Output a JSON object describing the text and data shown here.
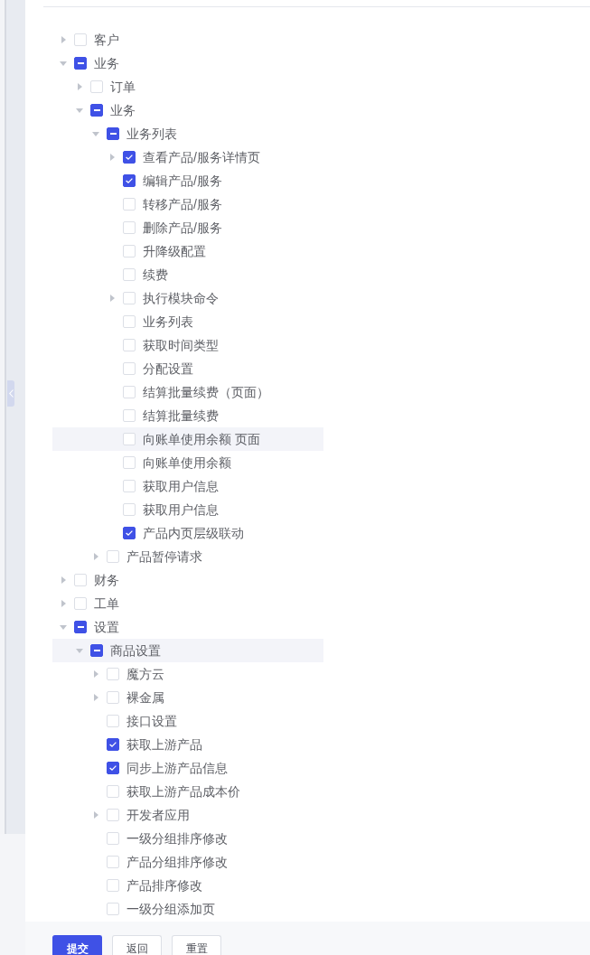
{
  "tree": [
    {
      "label": "客户",
      "expanded": false,
      "checked": false,
      "indeterminate": false,
      "highlighted": false
    },
    {
      "label": "业务",
      "expanded": true,
      "checked": false,
      "indeterminate": true,
      "highlighted": false,
      "children": [
        {
          "label": "订单",
          "expanded": false,
          "checked": false,
          "indeterminate": false,
          "highlighted": false
        },
        {
          "label": "业务",
          "expanded": true,
          "checked": false,
          "indeterminate": true,
          "highlighted": false,
          "children": [
            {
              "label": "业务列表",
              "expanded": true,
              "checked": false,
              "indeterminate": true,
              "highlighted": false,
              "children": [
                {
                  "label": "查看产品/服务详情页",
                  "expanded": false,
                  "checked": true,
                  "indeterminate": false,
                  "highlighted": false
                },
                {
                  "label": "编辑产品/服务",
                  "checked": true,
                  "indeterminate": false,
                  "highlighted": false
                },
                {
                  "label": "转移产品/服务",
                  "checked": false,
                  "indeterminate": false,
                  "highlighted": false
                },
                {
                  "label": "删除产品/服务",
                  "checked": false,
                  "indeterminate": false,
                  "highlighted": false
                },
                {
                  "label": "升降级配置",
                  "checked": false,
                  "indeterminate": false,
                  "highlighted": false
                },
                {
                  "label": "续费",
                  "checked": false,
                  "indeterminate": false,
                  "highlighted": false
                },
                {
                  "label": "执行模块命令",
                  "expanded": false,
                  "checked": false,
                  "indeterminate": false,
                  "highlighted": false
                },
                {
                  "label": "业务列表",
                  "checked": false,
                  "indeterminate": false,
                  "highlighted": false
                },
                {
                  "label": "获取时间类型",
                  "checked": false,
                  "indeterminate": false,
                  "highlighted": false
                },
                {
                  "label": "分配设置",
                  "checked": false,
                  "indeterminate": false,
                  "highlighted": false
                },
                {
                  "label": "结算批量续费（页面）",
                  "checked": false,
                  "indeterminate": false,
                  "highlighted": false
                },
                {
                  "label": "结算批量续费",
                  "checked": false,
                  "indeterminate": false,
                  "highlighted": false
                },
                {
                  "label": "向账单使用余额 页面",
                  "checked": false,
                  "indeterminate": false,
                  "highlighted": true
                },
                {
                  "label": "向账单使用余额",
                  "checked": false,
                  "indeterminate": false,
                  "highlighted": false
                },
                {
                  "label": "获取用户信息",
                  "checked": false,
                  "indeterminate": false,
                  "highlighted": false
                },
                {
                  "label": "获取用户信息",
                  "checked": false,
                  "indeterminate": false,
                  "highlighted": false
                },
                {
                  "label": "产品内页层级联动",
                  "checked": true,
                  "indeterminate": false,
                  "highlighted": false
                }
              ]
            },
            {
              "label": "产品暂停请求",
              "expanded": false,
              "checked": false,
              "indeterminate": false,
              "highlighted": false
            }
          ]
        }
      ]
    },
    {
      "label": "财务",
      "expanded": false,
      "checked": false,
      "indeterminate": false,
      "highlighted": false
    },
    {
      "label": "工单",
      "expanded": false,
      "checked": false,
      "indeterminate": false,
      "highlighted": false
    },
    {
      "label": "设置",
      "expanded": true,
      "checked": false,
      "indeterminate": true,
      "highlighted": false,
      "children": [
        {
          "label": "商品设置",
          "expanded": true,
          "checked": false,
          "indeterminate": true,
          "highlighted": true,
          "children": [
            {
              "label": "魔方云",
              "expanded": false,
              "checked": false,
              "indeterminate": false,
              "highlighted": false
            },
            {
              "label": "裸金属",
              "expanded": false,
              "checked": false,
              "indeterminate": false,
              "highlighted": false
            },
            {
              "label": "接口设置",
              "checked": false,
              "indeterminate": false,
              "highlighted": false
            },
            {
              "label": "获取上游产品",
              "checked": true,
              "indeterminate": false,
              "highlighted": false
            },
            {
              "label": "同步上游产品信息",
              "checked": true,
              "indeterminate": false,
              "highlighted": false
            },
            {
              "label": "获取上游产品成本价",
              "checked": false,
              "indeterminate": false,
              "highlighted": false
            },
            {
              "label": "开发者应用",
              "expanded": false,
              "checked": false,
              "indeterminate": false,
              "highlighted": false
            },
            {
              "label": "一级分组排序修改",
              "checked": false,
              "indeterminate": false,
              "highlighted": false
            },
            {
              "label": "产品分组排序修改",
              "checked": false,
              "indeterminate": false,
              "highlighted": false
            },
            {
              "label": "产品排序修改",
              "checked": false,
              "indeterminate": false,
              "highlighted": false
            },
            {
              "label": "一级分组添加页",
              "checked": false,
              "indeterminate": false,
              "highlighted": false
            }
          ]
        }
      ]
    }
  ],
  "buttons": [
    {
      "label": "提交",
      "kind": "primary"
    },
    {
      "label": "返回",
      "kind": "default"
    },
    {
      "label": "重置",
      "kind": "default"
    }
  ]
}
